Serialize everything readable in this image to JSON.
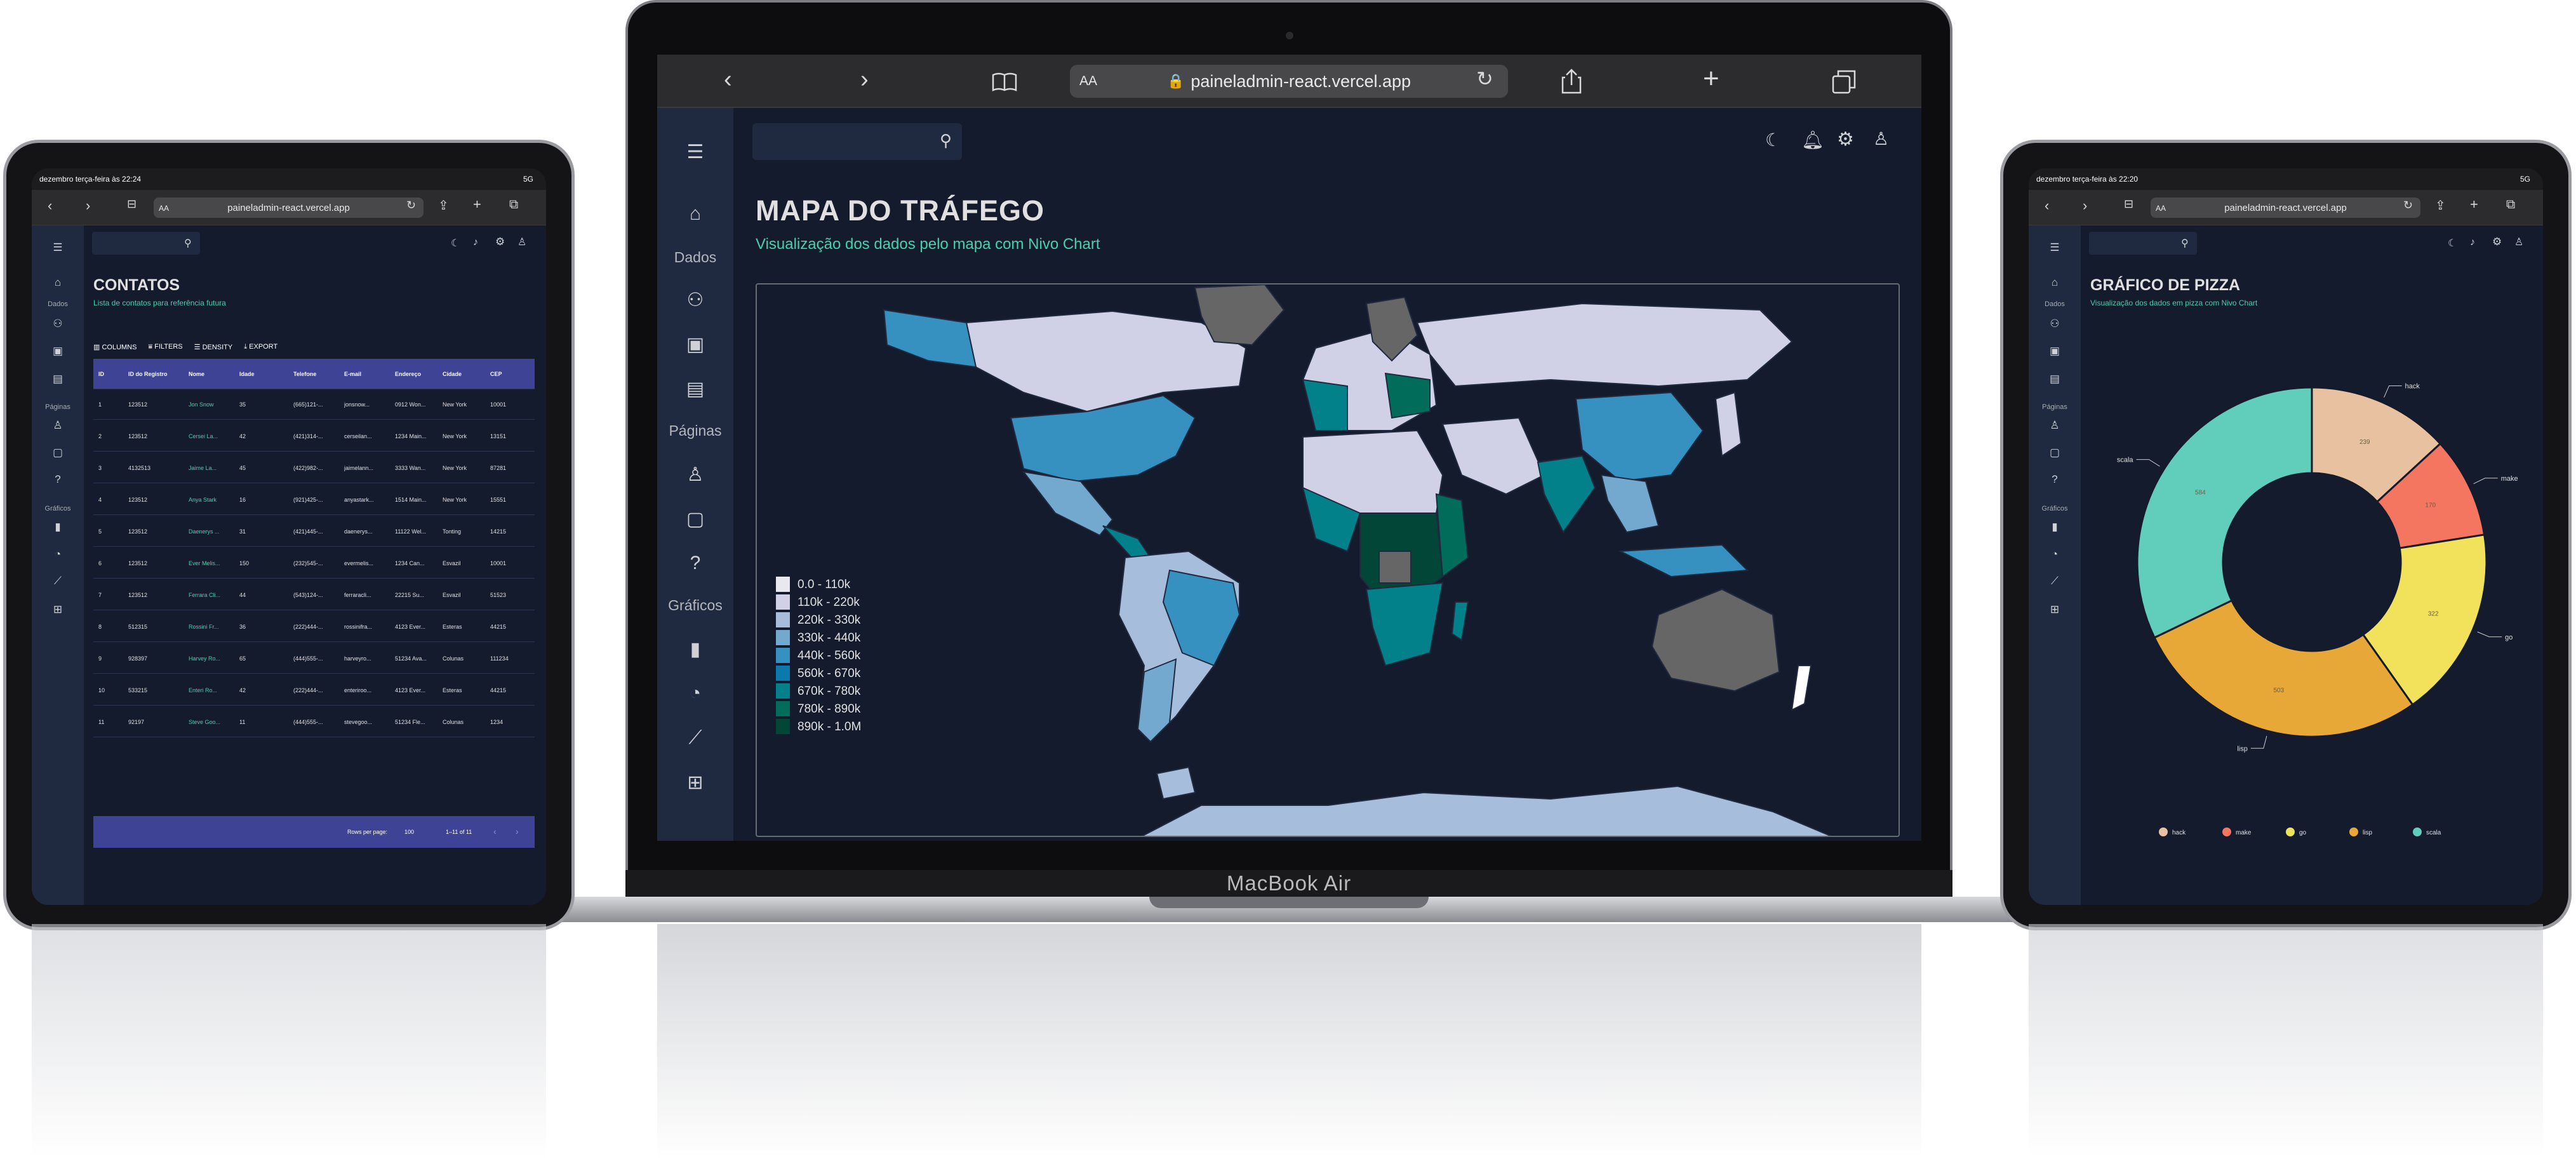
{
  "laptop": {
    "brand": "MacBook Air",
    "browser": {
      "url": "paineladmin-react.vercel.app",
      "aa": "AA",
      "icons": [
        "back-icon",
        "forward-icon",
        "book-icon",
        "reload-icon",
        "share-icon",
        "plus-icon",
        "tabs-icon"
      ]
    },
    "sidebar": {
      "section_dados": "Dados",
      "section_paginas": "Páginas",
      "section_graficos": "Gráficos"
    },
    "page": {
      "title": "MAPA DO TRÁFEGO",
      "subtitle": "Visualização dos dados pelo mapa com Nivo Chart"
    },
    "legend": [
      "0.0 - 110k",
      "110k - 220k",
      "220k - 330k",
      "330k - 440k",
      "440k - 560k",
      "560k - 670k",
      "670k - 780k",
      "780k - 890k",
      "890k - 1.0M"
    ],
    "legend_colors": [
      "#e8e8f0",
      "#d0d1e6",
      "#a6bddb",
      "#74a9cf",
      "#3690c0",
      "#0c79ad",
      "#02818a",
      "#016c59",
      "#014636"
    ]
  },
  "left_tablet": {
    "status_time": "dezembro terça-feira às 22:24",
    "status_right": "5G",
    "url": "paineladmin-react.vercel.app",
    "aa": "AA",
    "sidebar": {
      "section_dados": "Dados",
      "section_paginas": "Páginas",
      "section_graficos": "Gráficos"
    },
    "page": {
      "title": "CONTATOS",
      "subtitle": "Lista de contatos para referência futura"
    },
    "toolbar": {
      "columns": "COLUMNS",
      "filters": "FILTERS",
      "density": "DENSITY",
      "export": "EXPORT"
    },
    "columns": [
      "ID",
      "ID do Registro",
      "Nome",
      "Idade",
      "Telefone",
      "E-mail",
      "Endereço",
      "Cidade",
      "CEP"
    ],
    "rows": [
      [
        "1",
        "123512",
        "Jon Snow",
        "35",
        "(665)121-...",
        "jonsnow...",
        "0912 Won...",
        "New York",
        "10001"
      ],
      [
        "2",
        "123512",
        "Cersei La...",
        "42",
        "(421)314-...",
        "cerseilan...",
        "1234 Main...",
        "New York",
        "13151"
      ],
      [
        "3",
        "4132513",
        "Jaime La...",
        "45",
        "(422)982-...",
        "jaimelann...",
        "3333 Wan...",
        "New York",
        "87281"
      ],
      [
        "4",
        "123512",
        "Anya Stark",
        "16",
        "(921)425-...",
        "anyastark...",
        "1514 Main...",
        "New York",
        "15551"
      ],
      [
        "5",
        "123512",
        "Daenerys ...",
        "31",
        "(421)445-...",
        "daenerys...",
        "11122 Wel...",
        "Tonting",
        "14215"
      ],
      [
        "6",
        "123512",
        "Ever Melis...",
        "150",
        "(232)545-...",
        "evermelis...",
        "1234 Can...",
        "Esvazil",
        "10001"
      ],
      [
        "7",
        "123512",
        "Ferrara Cli...",
        "44",
        "(543)124-...",
        "ferraracli...",
        "22215 Su...",
        "Esvazil",
        "51523"
      ],
      [
        "8",
        "512315",
        "Rossini Fr...",
        "36",
        "(222)444-...",
        "rossinifra...",
        "4123 Ever...",
        "Esteras",
        "44215"
      ],
      [
        "9",
        "928397",
        "Harvey Ro...",
        "65",
        "(444)555-...",
        "harveyro...",
        "51234 Ava...",
        "Colunas",
        "111234"
      ],
      [
        "10",
        "533215",
        "Enteri Ro...",
        "42",
        "(222)444-...",
        "enteriroo...",
        "4123 Ever...",
        "Esteras",
        "44215"
      ],
      [
        "11",
        "92197",
        "Steve Goo...",
        "11",
        "(444)555-...",
        "stevegoo...",
        "51234 Fle...",
        "Colunas",
        "1234"
      ]
    ],
    "footer": {
      "rows_per_page_label": "Rows per page:",
      "rows_per_page_value": "100",
      "range": "1–11 of 11"
    }
  },
  "right_tablet": {
    "status_time": "dezembro terça-feira às 22:20",
    "status_right": "5G",
    "url": "paineladmin-react.vercel.app",
    "aa": "AA",
    "sidebar": {
      "section_dados": "Dados",
      "section_paginas": "Páginas",
      "section_graficos": "Gráficos"
    },
    "page": {
      "title": "GRÁFICO DE PIZZA",
      "subtitle": "Visualização dos dados em pizza com Nivo Chart"
    }
  },
  "chart_data": {
    "type": "pie",
    "categories": [
      "hack",
      "make",
      "go",
      "lisp",
      "scala"
    ],
    "values": [
      239,
      170,
      322,
      503,
      584
    ],
    "value_labels": [
      "239",
      "170",
      "322",
      "503",
      "584"
    ],
    "colors": [
      "#e8c1a0",
      "#f47560",
      "#f1e15b",
      "#e8a838",
      "#61cdbb"
    ],
    "legend_position": "bottom",
    "donut": true
  }
}
